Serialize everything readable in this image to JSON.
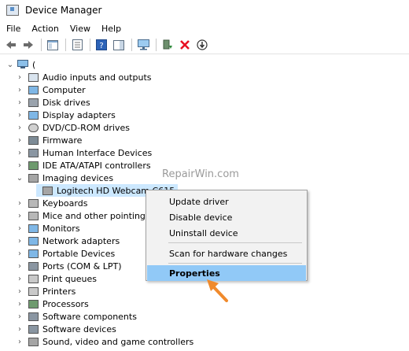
{
  "window": {
    "title": "Device Manager"
  },
  "menu": {
    "file": "File",
    "action": "Action",
    "view": "View",
    "help": "Help"
  },
  "tree": {
    "root_label": "(",
    "items": [
      "Audio inputs and outputs",
      "Computer",
      "Disk drives",
      "Display adapters",
      "DVD/CD-ROM drives",
      "Firmware",
      "Human Interface Devices",
      "IDE ATA/ATAPI controllers",
      "Imaging devices",
      "Logitech HD Webcam C615",
      "Keyboards",
      "Mice and other pointing de",
      "Monitors",
      "Network adapters",
      "Portable Devices",
      "Ports (COM & LPT)",
      "Print queues",
      "Printers",
      "Processors",
      "Software components",
      "Software devices",
      "Sound, video and game controllers"
    ]
  },
  "context_menu": {
    "update_driver": "Update driver",
    "disable_device": "Disable device",
    "uninstall_device": "Uninstall device",
    "scan_changes": "Scan for hardware changes",
    "properties": "Properties"
  },
  "watermark": "RepairWin.com",
  "colors": {
    "highlight": "#91c9f7",
    "selection": "#cce8ff",
    "arrow": "#f08a2c",
    "red_x": "#e81123"
  }
}
